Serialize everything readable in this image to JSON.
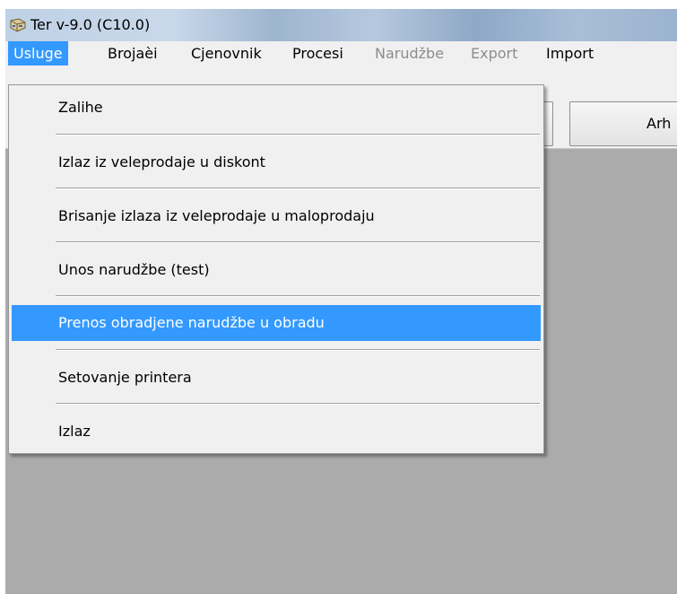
{
  "window": {
    "title": "Ter v-9.0  (C10.0)"
  },
  "menubar": {
    "items": [
      {
        "label": "Usluge",
        "state": "active"
      },
      {
        "label": "Brojaèi",
        "state": "normal"
      },
      {
        "label": "Cjenovnik",
        "state": "normal"
      },
      {
        "label": "Procesi",
        "state": "normal"
      },
      {
        "label": "Narudžbe",
        "state": "disabled"
      },
      {
        "label": "Export",
        "state": "disabled"
      },
      {
        "label": "Import",
        "state": "normal"
      }
    ]
  },
  "toolbar": {
    "archive_button_label": "Arh"
  },
  "dropdown": {
    "items": [
      {
        "label": "Zalihe"
      },
      {
        "label": "Izlaz iz veleprodaje u diskont"
      },
      {
        "label": "Brisanje izlaza iz veleprodaje u maloprodaju"
      },
      {
        "label": "Unos narudžbe (test)"
      },
      {
        "label": "Prenos obradjene narudžbe u obradu",
        "highlighted": true
      },
      {
        "label": "Setovanje printera"
      },
      {
        "label": "Izlaz"
      }
    ]
  },
  "colors": {
    "highlight": "#3399ff",
    "workspace": "#ababab",
    "disabled_text": "#8c8c8c"
  }
}
